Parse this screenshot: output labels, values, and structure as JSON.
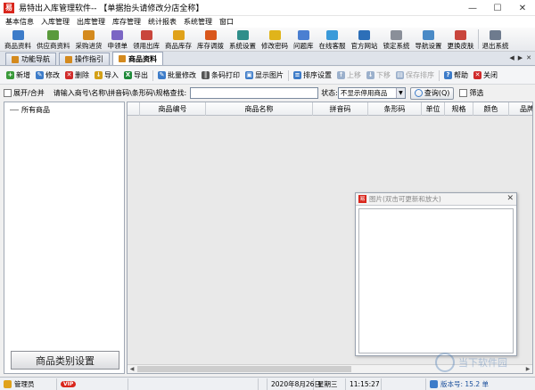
{
  "window": {
    "title": "易特出入库管理软件-- 【单据抬头请修改分店全称】",
    "controls": [
      "—",
      "☐",
      "✕"
    ]
  },
  "menu": [
    "基本信息",
    "入库管理",
    "出库管理",
    "库存管理",
    "统计报表",
    "系统管理",
    "窗口"
  ],
  "toolbar": [
    {
      "label": "商品资料",
      "icon": "product-icon",
      "color": "#3d7cc9"
    },
    {
      "label": "供应商资料",
      "icon": "supplier-icon",
      "color": "#5a9a3c"
    },
    {
      "label": "采购进货",
      "icon": "purchase-icon",
      "color": "#d48a1e"
    },
    {
      "label": "申领单",
      "icon": "requisition-icon",
      "color": "#7b66c4"
    },
    {
      "label": "领用出库",
      "icon": "outbound-icon",
      "color": "#c9463d"
    },
    {
      "label": "商品库存",
      "icon": "stock-icon",
      "color": "#e0a21a"
    },
    {
      "label": "库存调拨",
      "icon": "transfer-icon",
      "color": "#d9571c"
    },
    {
      "label": "系统设置",
      "icon": "settings-icon",
      "color": "#2f8e8a"
    },
    {
      "label": "修改密码",
      "icon": "password-icon",
      "color": "#e0b41a"
    },
    {
      "label": "问题库",
      "icon": "question-icon",
      "color": "#4b7fd1"
    },
    {
      "label": "在线客服",
      "icon": "support-icon",
      "color": "#3a9ad9"
    },
    {
      "label": "官方网站",
      "icon": "website-icon",
      "color": "#2d6fb8"
    },
    {
      "label": "锁定系统",
      "icon": "lock-icon",
      "color": "#8a8f99"
    },
    {
      "label": "导航设置",
      "icon": "navigation-icon",
      "color": "#4a8ac6"
    },
    {
      "label": "更换皮肤",
      "icon": "skin-icon",
      "color": "#c9463d"
    },
    {
      "label": "退出系统",
      "icon": "exit-icon",
      "color": "#6e7b8e"
    }
  ],
  "tabs": [
    {
      "label": "功能导航",
      "color": "#d48a1e"
    },
    {
      "label": "操作指引",
      "color": "#d48a1e"
    },
    {
      "label": "商品资料",
      "color": "#d48a1e"
    }
  ],
  "tab_nav": [
    "◀",
    "▶",
    "✕"
  ],
  "actions": [
    {
      "label": "新增",
      "symbol": "+",
      "color": "#3a9a3a",
      "disabled": false
    },
    {
      "label": "修改",
      "symbol": "✎",
      "color": "#3d7cc9",
      "disabled": false
    },
    {
      "label": "删除",
      "symbol": "✕",
      "color": "#d02a2a",
      "disabled": false
    },
    {
      "label": "导入",
      "symbol": "↓",
      "color": "#d4a017",
      "disabled": false
    },
    {
      "label": "导出",
      "symbol": "X",
      "color": "#1f8a3a",
      "disabled": false
    },
    {
      "label": "批量修改",
      "symbol": "✎",
      "color": "#3d7cc9",
      "disabled": false
    },
    {
      "label": "条码打印",
      "symbol": "║",
      "color": "#555555",
      "disabled": false
    },
    {
      "label": "显示图片",
      "symbol": "▣",
      "color": "#3d7cc9",
      "disabled": false
    },
    {
      "label": "排序设置",
      "symbol": "≡",
      "color": "#3d7cc9",
      "disabled": false
    },
    {
      "label": "上移",
      "symbol": "↑",
      "color": "#9bb0cc",
      "disabled": true
    },
    {
      "label": "下移",
      "symbol": "↓",
      "color": "#9bb0cc",
      "disabled": true
    },
    {
      "label": "保存排序",
      "symbol": "▤",
      "color": "#9bb0cc",
      "disabled": true
    },
    {
      "label": "帮助",
      "symbol": "?",
      "color": "#3d7cc9",
      "disabled": false
    },
    {
      "label": "关闭",
      "symbol": "✕",
      "color": "#d02a2a",
      "disabled": false
    }
  ],
  "search": {
    "expand_label": "展开/合并",
    "prompt": "请输入商号\\名称\\拼音码\\条形码\\规格查找:",
    "value": "",
    "status_label": "状态:",
    "status_value": "不显示停用商品",
    "query_label": "查询(Q)",
    "filter_label": "筛选"
  },
  "tree": {
    "root": "所有商品"
  },
  "category_button": "商品类别设置",
  "grid": {
    "columns": [
      "商品编号",
      "商品名称",
      "拼音码",
      "条形码",
      "单位",
      "规格",
      "颜色",
      "品牌"
    ]
  },
  "popup": {
    "title": "图片(双击可更新和放大)",
    "close": "✕"
  },
  "watermark": "当下软件园",
  "status": {
    "user": "管理员",
    "vip": "VIP",
    "date": "2020年8月26日",
    "weekday": "星期三",
    "time": "11:15:27",
    "version": "版本号: 15.2 单"
  },
  "colors": {
    "brand": "#d9261c",
    "accent": "#3d7cc9"
  }
}
